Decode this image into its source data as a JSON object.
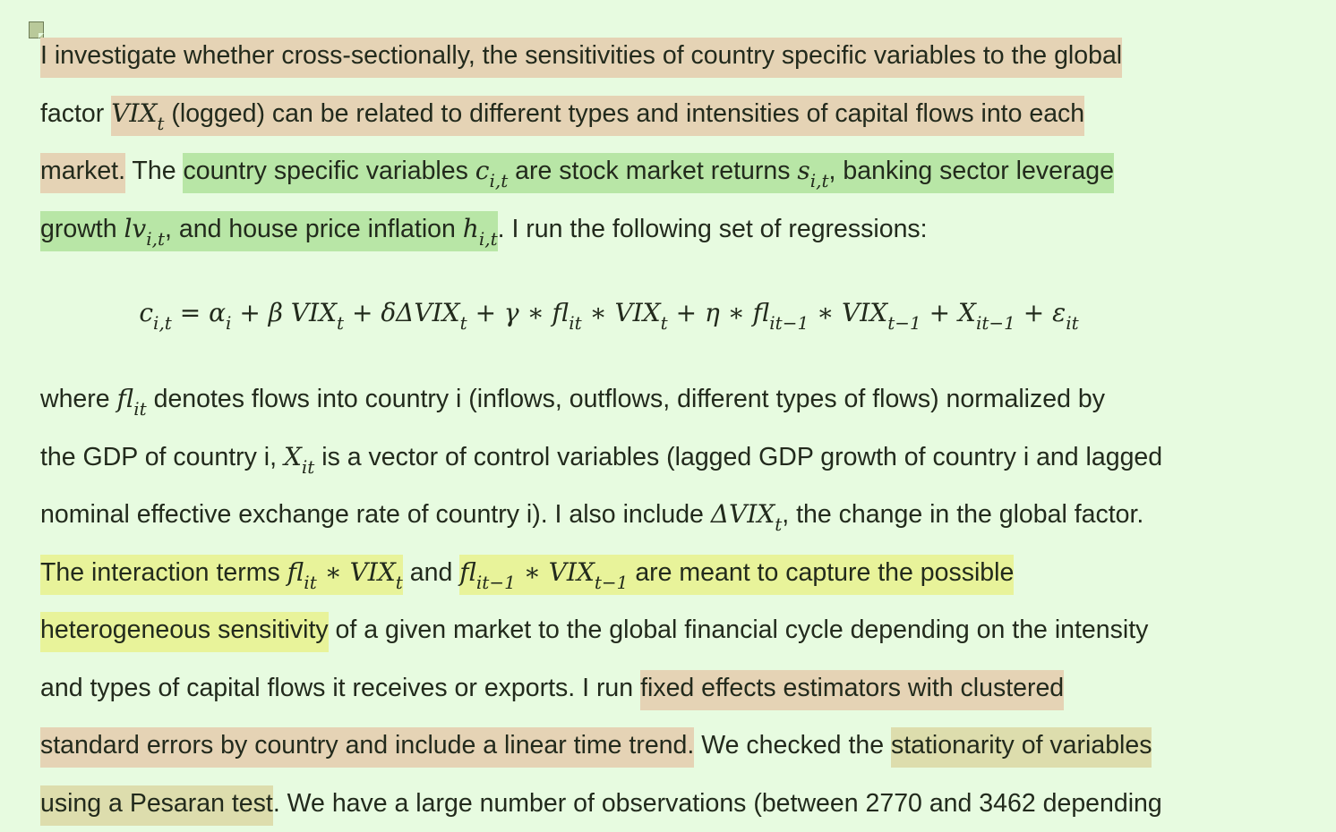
{
  "comment_icon": "comment-note-icon",
  "highlight_colors": {
    "tan": "#e5d3b5",
    "green": "#b8e6a6",
    "yellow": "#e8f39a",
    "khaki": "#ddddad"
  },
  "para1": {
    "l1": "I investigate whether cross-sectionally, the sensitivities of country specific variables to the global",
    "l2a": "factor ",
    "l2b": "VIX",
    "l2c": "t",
    "l2d": " (logged) can be related to different types and intensities of capital flows into each",
    "l3a": "market.",
    "l3b": " The ",
    "l3c": "country specific variables  ",
    "l3d": "c",
    "l3e": "i,t",
    "l3f": " are stock market returns ",
    "l3g": "s",
    "l3h": "i,t",
    "l3i": ", ",
    "l3j": "banking sector leverage",
    "l4a": "growth ",
    "l4b": "lv",
    "l4c": "i,t",
    "l4d": ",  and house price inflation ",
    "l4e": "h",
    "l4f": "i,t",
    "l4g": ".  I run the following set of regressions:"
  },
  "equation": {
    "c": "c",
    "c_sub": "i,t",
    "p1": " = ",
    "alpha": "α",
    "alpha_sub": "i",
    "p2": " + β VIX",
    "t1": "t",
    "p3": " + δΔVIX",
    "t2": "t",
    "p4": " + γ ∗ fl",
    "it1": "it",
    "p5": " ∗ VIX",
    "t3": "t",
    "p6": " + η ∗ fl",
    "itm1": "it−1",
    "p7": " ∗ VIX",
    "tm1": "t−1",
    "p8": " + X",
    "itm1b": "it−1",
    "p9": " + ε",
    "it2": "it"
  },
  "para2": {
    "l1a": "where  ",
    "l1b": "fl",
    "l1c": "it",
    "l1d": " denotes flows into country i  (inflows, outflows, different types of flows) normalized by",
    "l2a": "the GDP of country i,  ",
    "l2b": "X",
    "l2c": "it",
    "l2d": "  is a vector of control variables (lagged GDP growth of country i and lagged",
    "l3a": "nominal effective exchange rate  of country i).  I also include ",
    "l3b": "ΔVIX",
    "l3c": "t",
    "l3d": ", the change in the global factor.",
    "l4a": "The interaction terms ",
    "l4b": "fl",
    "l4c": "it",
    "l4d": " ∗ VIX",
    "l4e": "t",
    "l4f": " and ",
    "l4g": "fl",
    "l4h": "it−1",
    "l4i": " ∗ VIX",
    "l4j": "t−1",
    "l4k": " are meant to capture the possible",
    "l5a": "heterogeneous sensitivity",
    "l5b": " of a given market to the global financial cycle depending on the intensity",
    "l6a": "and types of capital flows it receives or exports. I run ",
    "l6b": "fixed effects estimators with clustered",
    "l7a": "standard errors by country and include a linear time trend.",
    "l7b": "  We checked the ",
    "l7c": "stationarity of variables",
    "l8a": "using a Pesaran test",
    "l8b": ". We have a large number of observations (between 2770 and 3462 depending"
  }
}
